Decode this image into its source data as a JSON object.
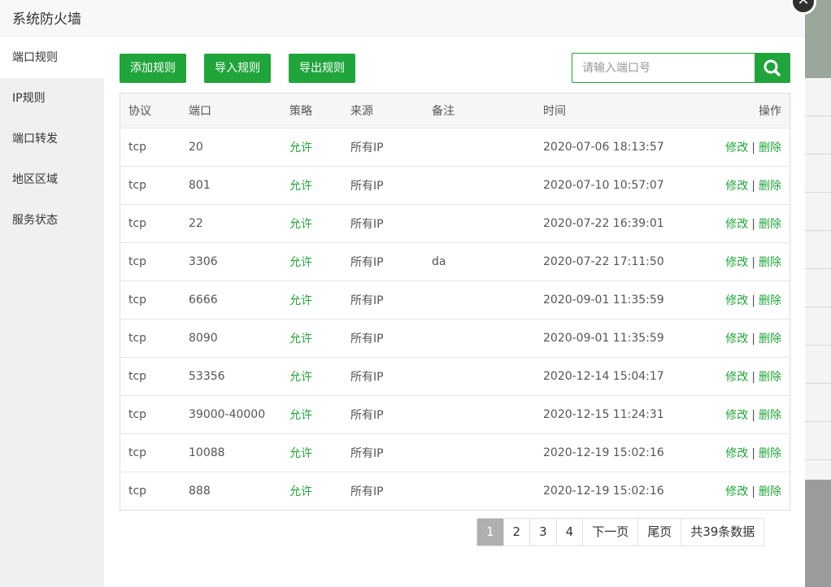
{
  "dialog": {
    "title": "系统防火墙",
    "close_symbol": "✕"
  },
  "sidebar": {
    "items": [
      {
        "label": "端口规则",
        "active": true
      },
      {
        "label": "IP规则"
      },
      {
        "label": "端口转发"
      },
      {
        "label": "地区区域"
      },
      {
        "label": "服务状态"
      }
    ]
  },
  "toolbar": {
    "add_label": "添加规则",
    "import_label": "导入规则",
    "export_label": "导出规则",
    "search_placeholder": "请输入端口号",
    "search_icon": "search-icon"
  },
  "table": {
    "headers": {
      "protocol": "协议",
      "port": "端口",
      "policy": "策略",
      "source": "来源",
      "note": "备注",
      "time": "时间",
      "action": "操作"
    },
    "rows": [
      {
        "protocol": "tcp",
        "port": "20",
        "policy": "允许",
        "source": "所有IP",
        "note": "",
        "time": "2020-07-06 18:13:57"
      },
      {
        "protocol": "tcp",
        "port": "801",
        "policy": "允许",
        "source": "所有IP",
        "note": "",
        "time": "2020-07-10 10:57:07"
      },
      {
        "protocol": "tcp",
        "port": "22",
        "policy": "允许",
        "source": "所有IP",
        "note": "",
        "time": "2020-07-22 16:39:01"
      },
      {
        "protocol": "tcp",
        "port": "3306",
        "policy": "允许",
        "source": "所有IP",
        "note": "da",
        "time": "2020-07-22 17:11:50"
      },
      {
        "protocol": "tcp",
        "port": "6666",
        "policy": "允许",
        "source": "所有IP",
        "note": "",
        "time": "2020-09-01 11:35:59"
      },
      {
        "protocol": "tcp",
        "port": "8090",
        "policy": "允许",
        "source": "所有IP",
        "note": "",
        "time": "2020-09-01 11:35:59"
      },
      {
        "protocol": "tcp",
        "port": "53356",
        "policy": "允许",
        "source": "所有IP",
        "note": "",
        "time": "2020-12-14 15:04:17"
      },
      {
        "protocol": "tcp",
        "port": "39000-40000",
        "policy": "允许",
        "source": "所有IP",
        "note": "",
        "time": "2020-12-15 11:24:31"
      },
      {
        "protocol": "tcp",
        "port": "10088",
        "policy": "允许",
        "source": "所有IP",
        "note": "",
        "time": "2020-12-19 15:02:16"
      },
      {
        "protocol": "tcp",
        "port": "888",
        "policy": "允许",
        "source": "所有IP",
        "note": "",
        "time": "2020-12-19 15:02:16"
      }
    ],
    "edit_label": "修改",
    "separator": "|",
    "delete_label": "删除"
  },
  "pagination": {
    "pages": [
      "1",
      "2",
      "3",
      "4"
    ],
    "current": "1",
    "next_label": "下一页",
    "last_label": "尾页",
    "total_label": "共39条数据"
  },
  "colors": {
    "accent": "#20a53a",
    "current_page": "#b0b0b0"
  }
}
